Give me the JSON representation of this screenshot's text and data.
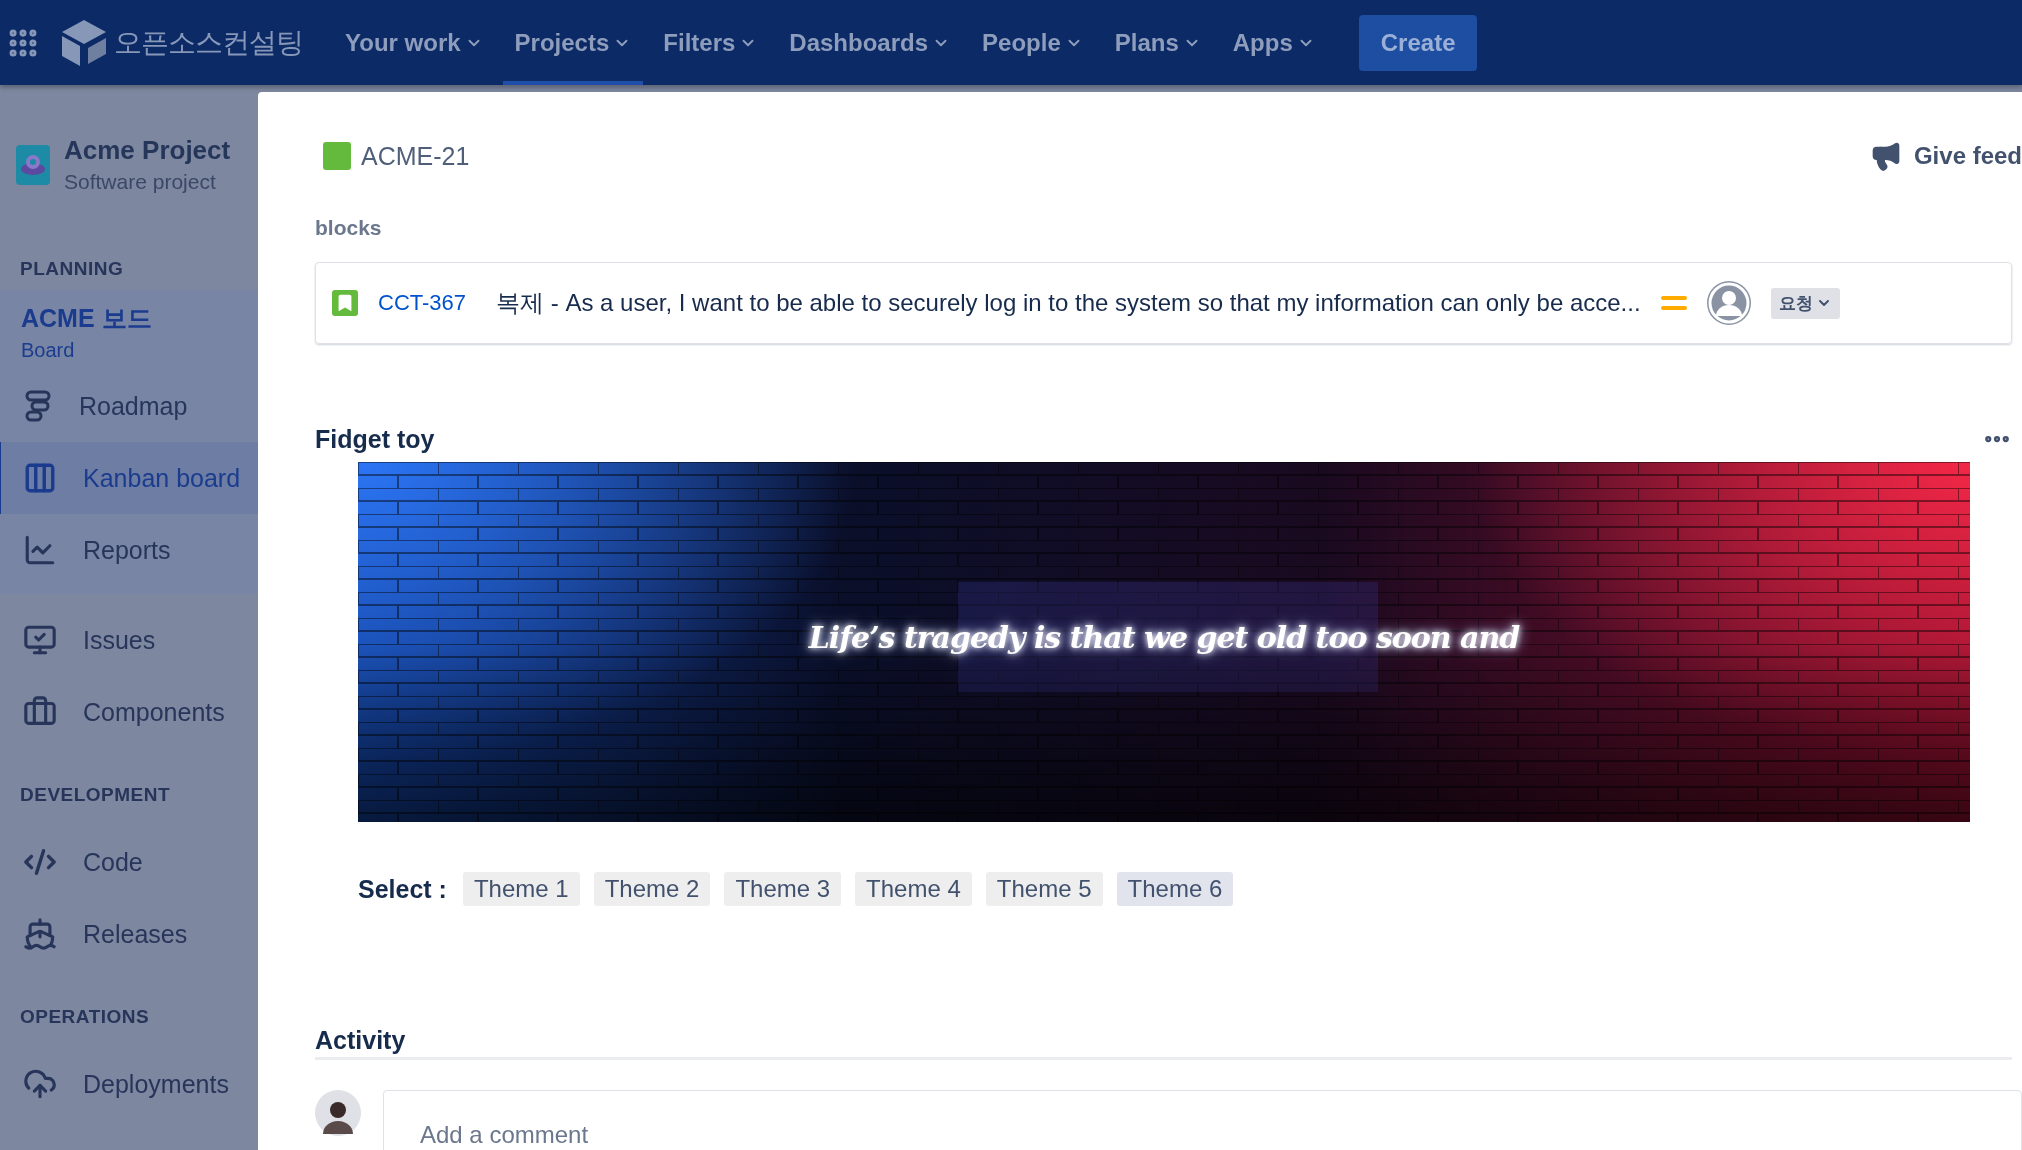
{
  "nav": {
    "app_name": "오픈소스컨설팅",
    "menus": [
      {
        "label": "Your work",
        "selected": false
      },
      {
        "label": "Projects",
        "selected": true
      },
      {
        "label": "Filters",
        "selected": false
      },
      {
        "label": "Dashboards",
        "selected": false
      },
      {
        "label": "People",
        "selected": false
      },
      {
        "label": "Plans",
        "selected": false
      },
      {
        "label": "Apps",
        "selected": false
      }
    ],
    "create": "Create"
  },
  "sidebar": {
    "project": {
      "name": "Acme Project",
      "type": "Software project"
    },
    "board": {
      "name": "ACME 보드",
      "type": "Board"
    },
    "sections": [
      {
        "heading": "PLANNING",
        "items": [
          {
            "label": "Roadmap",
            "selected": false
          },
          {
            "label": "Kanban board",
            "selected": true
          },
          {
            "label": "Reports",
            "selected": false
          }
        ]
      },
      {
        "items": [
          {
            "label": "Issues",
            "selected": false
          },
          {
            "label": "Components",
            "selected": false
          }
        ]
      },
      {
        "heading": "DEVELOPMENT",
        "items": [
          {
            "label": "Code",
            "selected": false
          },
          {
            "label": "Releases",
            "selected": false
          }
        ]
      },
      {
        "heading": "OPERATIONS",
        "items": [
          {
            "label": "Deployments",
            "selected": false
          }
        ]
      }
    ]
  },
  "issue": {
    "key": "ACME-21",
    "feedback": "Give feed",
    "links": {
      "heading": "blocks",
      "items": [
        {
          "key": "CCT-367",
          "summary": "복제 - As a user, I want to be able to securely log in to the system so that my information can only be acce...",
          "status": "요청"
        }
      ]
    },
    "widget": {
      "title": "Fidget toy",
      "neon_text": "Life’s tragedy is that we get old too soon and",
      "select_label": "Select :",
      "themes": [
        {
          "label": "Theme 1",
          "selected": false
        },
        {
          "label": "Theme 2",
          "selected": false
        },
        {
          "label": "Theme 3",
          "selected": false
        },
        {
          "label": "Theme 4",
          "selected": false
        },
        {
          "label": "Theme 5",
          "selected": false
        },
        {
          "label": "Theme 6",
          "selected": true
        }
      ]
    },
    "activity": {
      "heading": "Activity",
      "comment_placeholder": "Add a comment"
    }
  }
}
